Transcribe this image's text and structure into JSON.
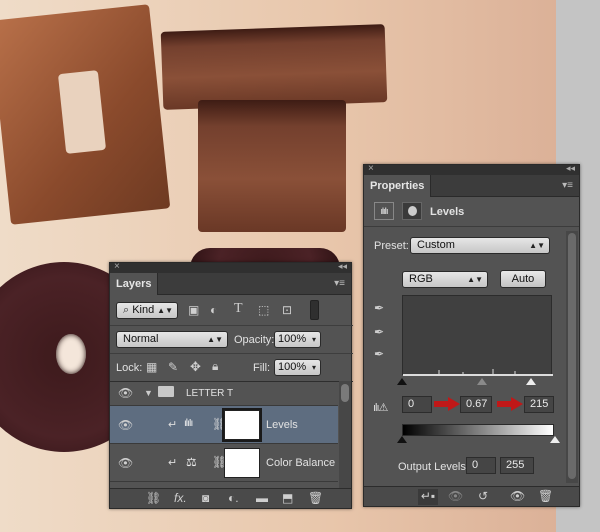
{
  "layers_panel": {
    "tab": "Layers",
    "filter_kind": "Kind",
    "blend_mode": "Normal",
    "opacity_label": "Opacity:",
    "opacity_value": "100%",
    "lock_label": "Lock:",
    "fill_label": "Fill:",
    "fill_value": "100%",
    "group": {
      "name": "LETTER T"
    },
    "layers": [
      {
        "name": "Levels"
      },
      {
        "name": "Color Balance"
      }
    ]
  },
  "properties_panel": {
    "tab": "Properties",
    "adjustment_title": "Levels",
    "preset_label": "Preset:",
    "preset_value": "Custom",
    "channel_value": "RGB",
    "auto_button": "Auto",
    "input_black": "0",
    "input_gamma": "0.67",
    "input_white": "215",
    "output_label": "Output Levels:",
    "output_black": "0",
    "output_white": "255"
  },
  "colors": {
    "annotation_arrow": "#c01818",
    "selected_row": "#5e6d80"
  }
}
